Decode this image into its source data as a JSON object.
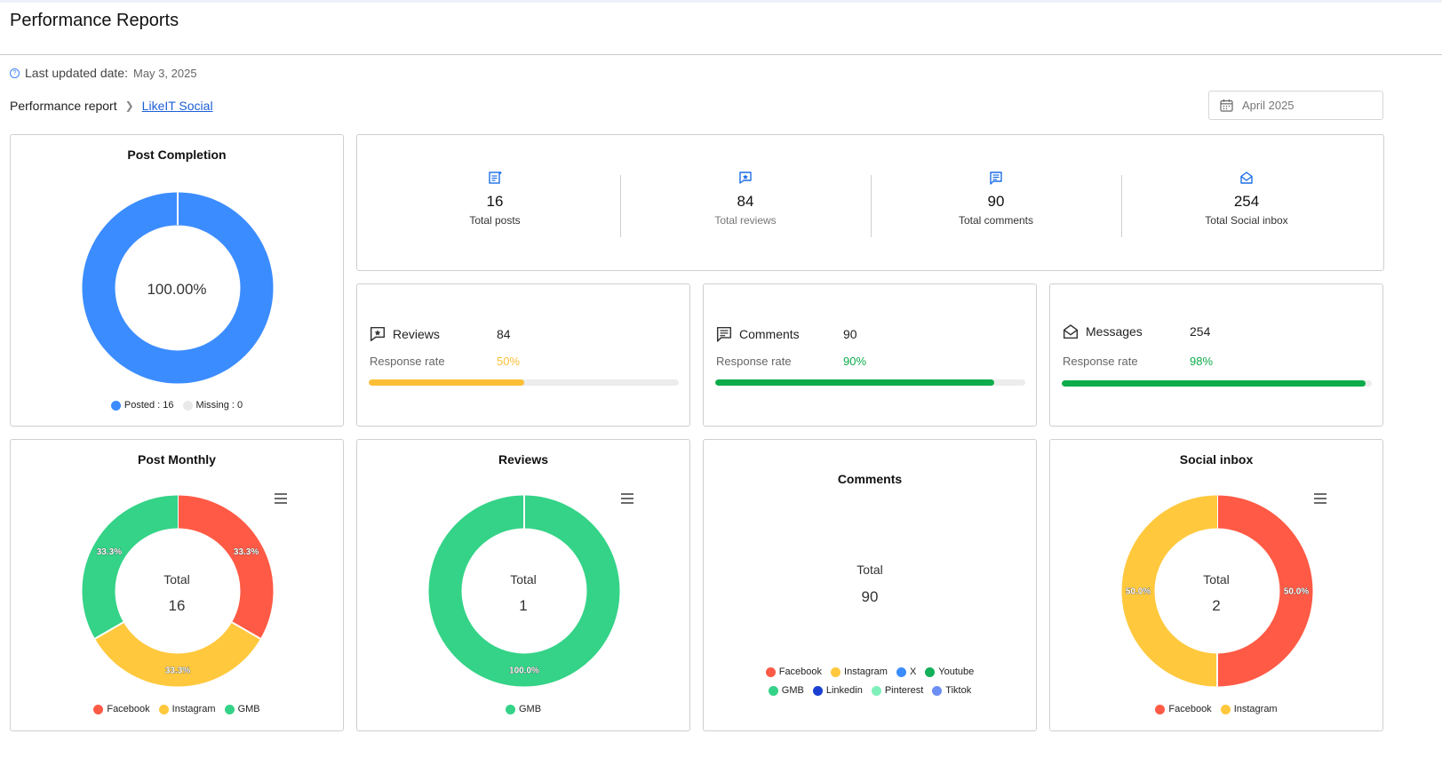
{
  "header": {
    "title": "Performance Reports"
  },
  "meta": {
    "label": "Last updated date:",
    "value": "May 3, 2025"
  },
  "breadcrumb": {
    "root": "Performance report",
    "current": "LikeIT Social"
  },
  "date_picker": {
    "value": "April 2025"
  },
  "post_completion": {
    "title": "Post Completion",
    "center": "100.00%",
    "legend": [
      {
        "label": "Posted : 16",
        "color": "#3b8cff"
      },
      {
        "label": "Missing : 0",
        "color": "#e9e9e9"
      }
    ]
  },
  "totals": [
    {
      "icon": "post-list-icon",
      "value": "16",
      "label": "Total posts"
    },
    {
      "icon": "review-star-icon",
      "value": "84",
      "label": "Total reviews"
    },
    {
      "icon": "comment-lines-icon",
      "value": "90",
      "label": "Total comments"
    },
    {
      "icon": "open-envelope-icon",
      "value": "254",
      "label": "Total Social inbox"
    }
  ],
  "metrics": [
    {
      "icon": "review-star-icon",
      "name": "Reviews",
      "value": "84",
      "rate_label": "Response rate",
      "rate": "50%",
      "fraction": 0.5,
      "color": "#fbbf36"
    },
    {
      "icon": "comment-lines-icon",
      "name": "Comments",
      "value": "90",
      "rate_label": "Response rate",
      "rate": "90%",
      "fraction": 0.9,
      "color": "#0cac4a"
    },
    {
      "icon": "open-envelope-icon",
      "name": "Messages",
      "value": "254",
      "rate_label": "Response rate",
      "rate": "98%",
      "fraction": 0.98,
      "color": "#0cac4a"
    }
  ],
  "post_monthly": {
    "title": "Post Monthly",
    "total_label": "Total",
    "total": "16",
    "legend": [
      {
        "label": "Facebook",
        "color": "#ff5a45"
      },
      {
        "label": "Instagram",
        "color": "#ffc83d"
      },
      {
        "label": "GMB",
        "color": "#34d387"
      }
    ]
  },
  "reviews_chart": {
    "title": "Reviews",
    "total_label": "Total",
    "total": "1",
    "legend": [
      {
        "label": "GMB",
        "color": "#34d387"
      }
    ]
  },
  "comments_chart": {
    "title": "Comments",
    "total_label": "Total",
    "total": "90",
    "legend_row1": [
      {
        "label": "Facebook",
        "color": "#ff5a45"
      },
      {
        "label": "Instagram",
        "color": "#ffc83d"
      },
      {
        "label": "X",
        "color": "#3b8cff"
      },
      {
        "label": "Youtube",
        "color": "#12b05a"
      }
    ],
    "legend_row2": [
      {
        "label": "GMB",
        "color": "#34d387"
      },
      {
        "label": "Linkedin",
        "color": "#1a3fd1"
      },
      {
        "label": "Pinterest",
        "color": "#7ff0b9"
      },
      {
        "label": "Tiktok",
        "color": "#6d8ff5"
      }
    ]
  },
  "social_inbox_chart": {
    "title": "Social inbox",
    "total_label": "Total",
    "total": "2",
    "legend": [
      {
        "label": "Facebook",
        "color": "#ff5a45"
      },
      {
        "label": "Instagram",
        "color": "#ffc83d"
      }
    ]
  },
  "chart_data": [
    {
      "type": "pie",
      "title": "Post Completion",
      "categories": [
        "Posted",
        "Missing"
      ],
      "values": [
        16,
        0
      ],
      "center_text": "100.00%"
    },
    {
      "type": "pie",
      "title": "Post Monthly",
      "categories": [
        "Facebook",
        "Instagram",
        "GMB"
      ],
      "values": [
        33.3,
        33.3,
        33.3
      ],
      "data_labels": [
        "33.3%",
        "33.3%",
        "33.3%"
      ],
      "center_text": "Total 16",
      "colors": [
        "#ff5a45",
        "#ffc83d",
        "#34d387"
      ]
    },
    {
      "type": "pie",
      "title": "Reviews",
      "categories": [
        "GMB"
      ],
      "values": [
        100.0
      ],
      "data_labels": [
        "100.0%"
      ],
      "center_text": "Total 1",
      "colors": [
        "#34d387"
      ]
    },
    {
      "type": "pie",
      "title": "Social inbox",
      "categories": [
        "Facebook",
        "Instagram"
      ],
      "values": [
        50.0,
        50.0
      ],
      "data_labels": [
        "50.0%",
        "50.0%"
      ],
      "center_text": "Total 2",
      "colors": [
        "#ff5a45",
        "#ffc83d"
      ]
    }
  ]
}
